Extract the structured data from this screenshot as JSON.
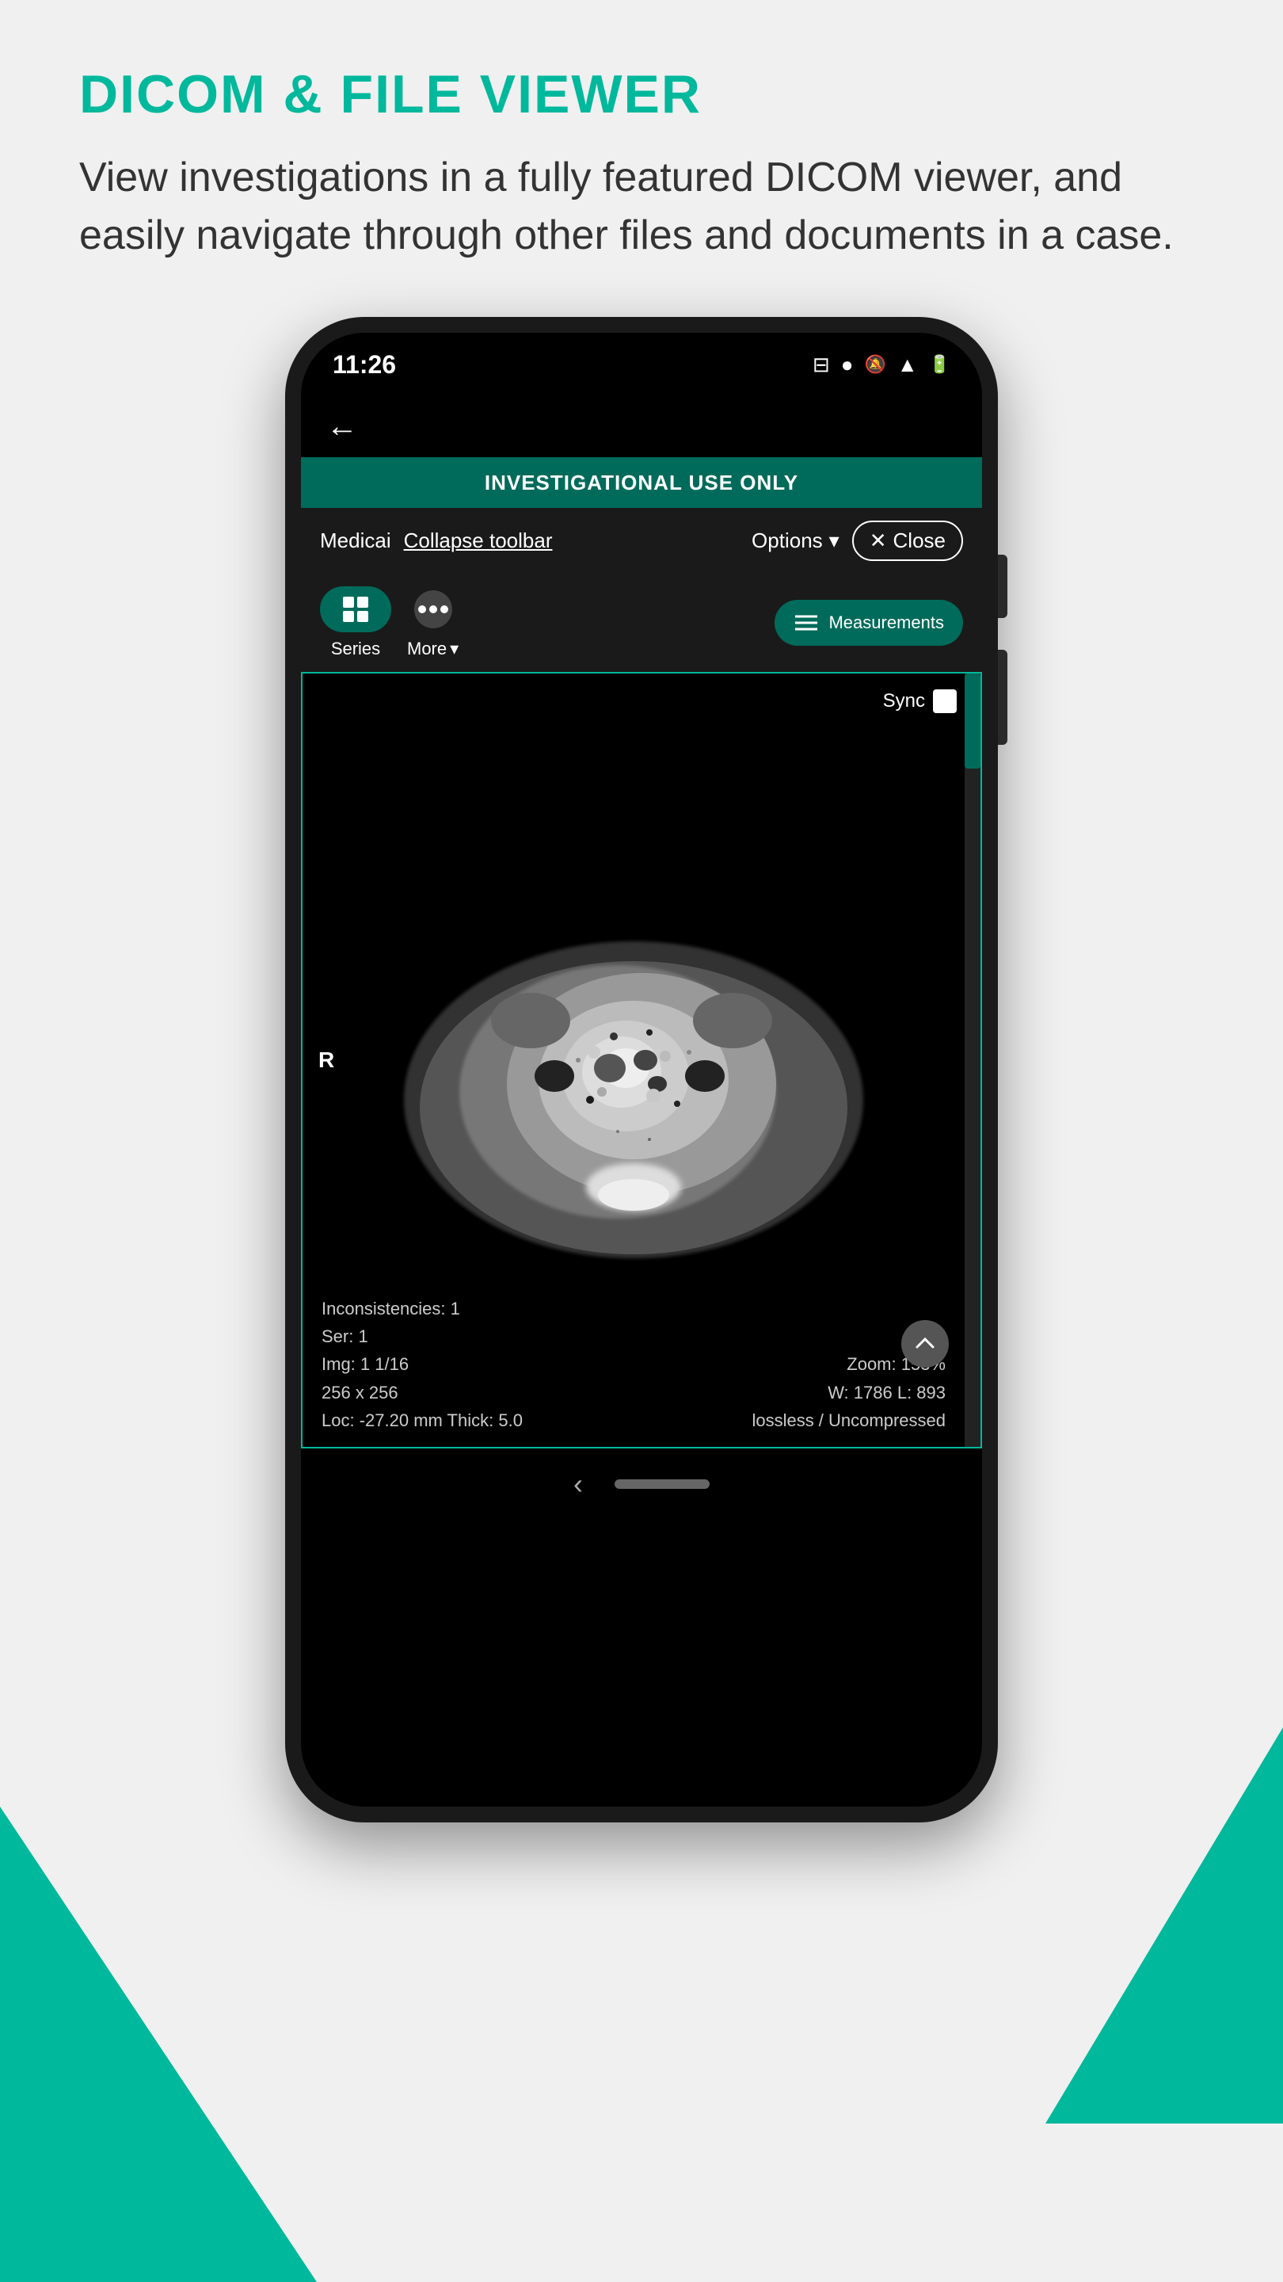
{
  "page": {
    "background": "#f0f0f0",
    "accent_color": "#00b89c"
  },
  "header": {
    "title": "DICOM & FILE VIEWER",
    "description": "View investigations in a fully featured DICOM viewer, and easily navigate through other files and documents in a case."
  },
  "status_bar": {
    "time": "11:26",
    "icons": [
      "sim-icon",
      "circle-icon",
      "bell-mute-icon",
      "wifi-icon",
      "battery-icon"
    ]
  },
  "app": {
    "back_label": "←",
    "investigational_banner": "INVESTIGATIONAL USE ONLY",
    "toolbar": {
      "medicai_label": "Medicai",
      "collapse_label": "Collapse toolbar",
      "options_label": "Options",
      "close_label": "Close"
    },
    "tools": {
      "series_label": "Series",
      "more_label": "More",
      "more_arrow": "▾",
      "measurements_label": "Measurements"
    },
    "viewer": {
      "sync_label": "Sync",
      "r_label": "R",
      "info": {
        "line1": "Inconsistencies: 1",
        "line2": "Ser: 1",
        "line3": "Img: 1 1/16",
        "line3_right": "Zoom: 153%",
        "line4": "256 x 256",
        "line4_right": "W: 1786 L: 893",
        "line5": "Loc: -27.20 mm Thick: 5.0",
        "line5_right": "lossless / Uncompressed"
      }
    }
  },
  "bottom_nav": {
    "back_label": "‹"
  }
}
